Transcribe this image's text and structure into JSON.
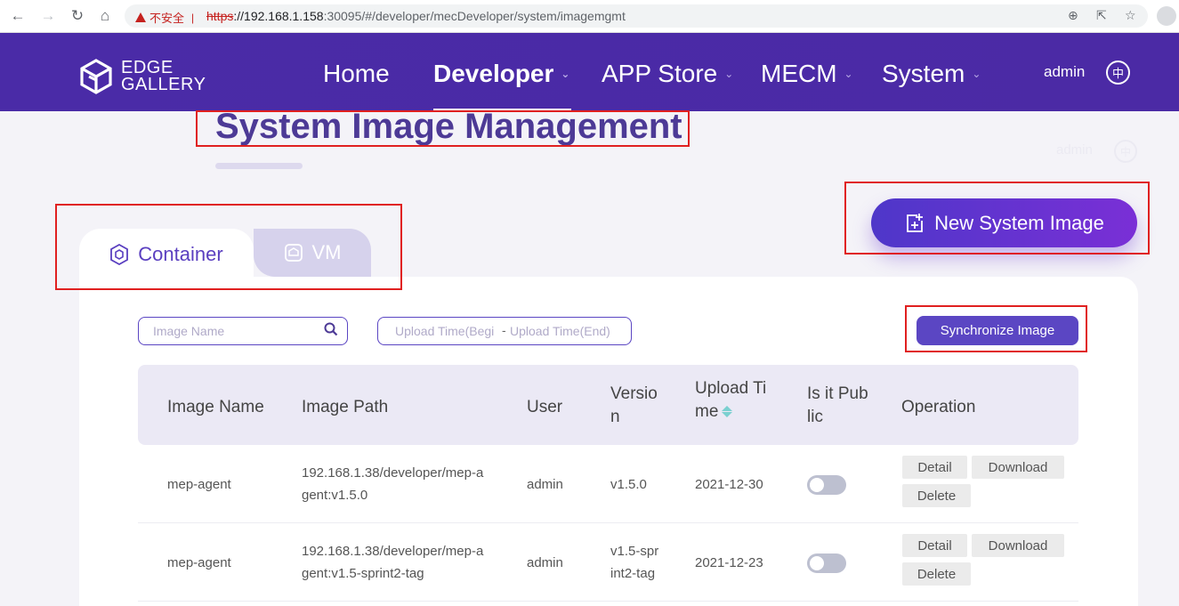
{
  "browser": {
    "warning": "不安全",
    "url_scheme": "https",
    "url_host": "://192.168.1.158",
    "url_rest": ":30095/#/developer/mecDeveloper/system/imagemgmt"
  },
  "header": {
    "logo_line1": "EDGE",
    "logo_line2": "GALLERY",
    "nav": [
      {
        "label": "Home"
      },
      {
        "label": "Developer"
      },
      {
        "label": "APP Store"
      },
      {
        "label": "MECM"
      },
      {
        "label": "System"
      }
    ],
    "user": "admin",
    "lang": "中"
  },
  "page": {
    "title": "System Image Management",
    "ghost_user": "admin",
    "ghost_lang": "中",
    "new_button": "New System Image"
  },
  "tabs": [
    {
      "label": "Container",
      "icon": "container-icon"
    },
    {
      "label": "VM",
      "icon": "vm-icon"
    }
  ],
  "filters": {
    "search_placeholder": "Image Name",
    "date_start_placeholder": "Upload Time(Begi",
    "date_sep": "-",
    "date_end_placeholder": "Upload Time(End)",
    "sync_button": "Synchronize Image"
  },
  "table": {
    "headers": {
      "name": "Image Name",
      "path": "Image Path",
      "user": "User",
      "version_1": "Versio",
      "version_2": "n",
      "time_1": "Upload Ti",
      "time_2": "me",
      "public_1": "Is it Pub",
      "public_2": "lic",
      "operation": "Operation"
    },
    "rows": [
      {
        "name": "mep-agent",
        "path_1": "192.168.1.38/developer/mep-a",
        "path_2": "gent:v1.5.0",
        "user": "admin",
        "version_1": "v1.5.0",
        "version_2": "",
        "time": "2021-12-30",
        "public": false,
        "detail": "Detail",
        "download": "Download",
        "delete": "Delete"
      },
      {
        "name": "mep-agent",
        "path_1": "192.168.1.38/developer/mep-a",
        "path_2": "gent:v1.5-sprint2-tag",
        "user": "admin",
        "version_1": "v1.5-spr",
        "version_2": "int2-tag",
        "time": "2021-12-23",
        "public": false,
        "detail": "Detail",
        "download": "Download",
        "delete": "Delete"
      }
    ]
  },
  "colors": {
    "header_bg": "#4a2ba7",
    "accent": "#5b46c3",
    "annotation_red": "#e02020"
  }
}
